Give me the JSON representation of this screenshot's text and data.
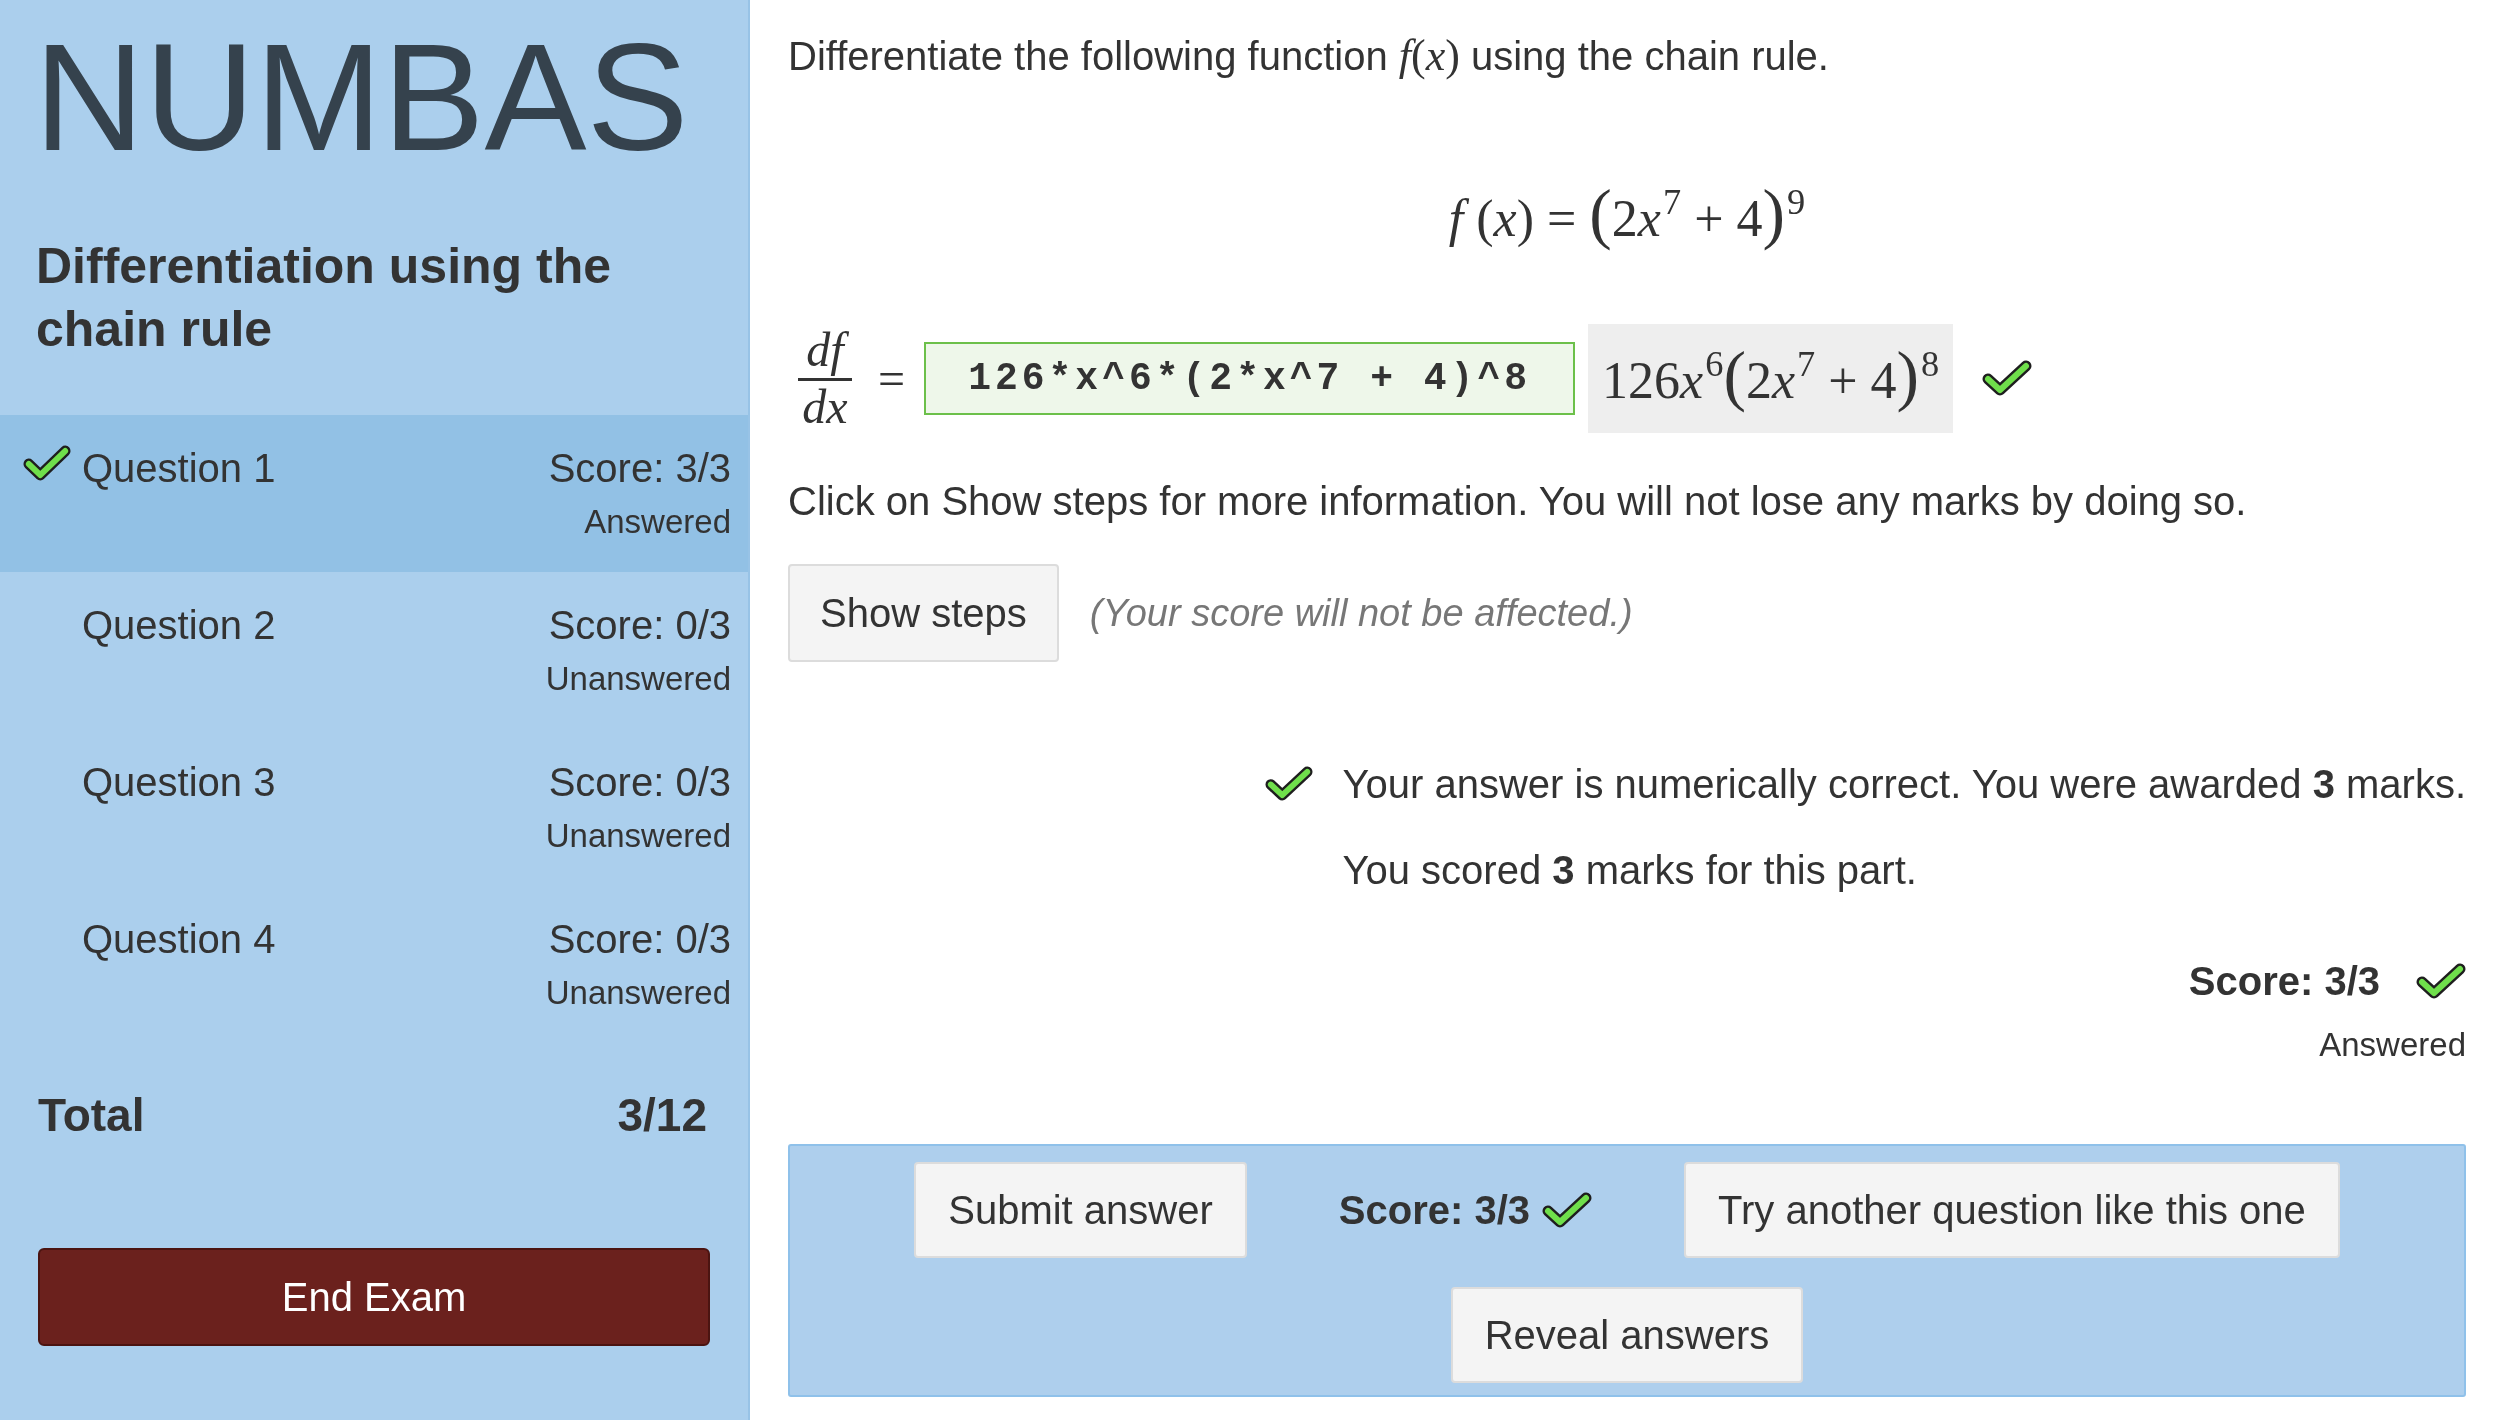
{
  "sidebar": {
    "logo": "NUMBAS",
    "exam_title": "Differentiation using the chain rule",
    "questions": [
      {
        "label": "Question 1",
        "score": "Score: 3/3",
        "status": "Answered",
        "selected": true,
        "correct": true
      },
      {
        "label": "Question 2",
        "score": "Score: 0/3",
        "status": "Unanswered",
        "selected": false,
        "correct": false
      },
      {
        "label": "Question 3",
        "score": "Score: 0/3",
        "status": "Unanswered",
        "selected": false,
        "correct": false
      },
      {
        "label": "Question 4",
        "score": "Score: 0/3",
        "status": "Unanswered",
        "selected": false,
        "correct": false
      }
    ],
    "total": {
      "label": "Total",
      "value": "3/12"
    },
    "end_button": "End Exam"
  },
  "question": {
    "prompt_before": "Differentiate the following function",
    "prompt_math": "*f*(*x*)",
    "prompt_after": "using the chain rule.",
    "formula": [
      {
        "kind": "var",
        "text": "f"
      },
      {
        "kind": "op",
        "text": " ("
      },
      {
        "kind": "var",
        "text": "x"
      },
      {
        "kind": "op",
        "text": ") = "
      },
      {
        "kind": "paren",
        "text": "("
      },
      {
        "kind": "num",
        "text": "2"
      },
      {
        "kind": "var",
        "text": "x"
      },
      {
        "kind": "sup",
        "text": "7"
      },
      {
        "kind": "op",
        "text": " + 4"
      },
      {
        "kind": "paren",
        "text": ")"
      },
      {
        "kind": "sup",
        "text": "9"
      }
    ]
  },
  "answer": {
    "numerator": "df",
    "denominator": "dx",
    "relation": "=",
    "value": "126*x^6*(2*x^7 + 4)^8",
    "preview": [
      {
        "kind": "num",
        "text": "126"
      },
      {
        "kind": "var",
        "text": "x"
      },
      {
        "kind": "sup",
        "text": "6"
      },
      {
        "kind": "paren",
        "text": "("
      },
      {
        "kind": "num",
        "text": "2"
      },
      {
        "kind": "var",
        "text": "x"
      },
      {
        "kind": "sup",
        "text": "7"
      },
      {
        "kind": "op",
        "text": " + 4"
      },
      {
        "kind": "paren",
        "text": ")"
      },
      {
        "kind": "sup",
        "text": "8"
      }
    ],
    "correct": true
  },
  "hint": "Click on Show steps for more information. You will not lose any marks by doing so.",
  "steps": {
    "button": "Show steps",
    "note": "(Your score will not be affected.)"
  },
  "feedback": [
    {
      "kind": "correct",
      "text": "Your answer is numerically correct. You were awarded **3** marks."
    },
    {
      "kind": "summary",
      "text": "You scored **3** marks for this part."
    }
  ],
  "part_score": {
    "score": "Score: 3/3",
    "status": "Answered",
    "correct": true
  },
  "controls": [
    {
      "kind": "button",
      "label": "Submit answer"
    },
    {
      "kind": "score",
      "label": "Score: 3/3",
      "correct": true
    },
    {
      "kind": "button",
      "label": "Try another question like this one"
    },
    {
      "kind": "button",
      "label": "Reveal answers"
    }
  ]
}
